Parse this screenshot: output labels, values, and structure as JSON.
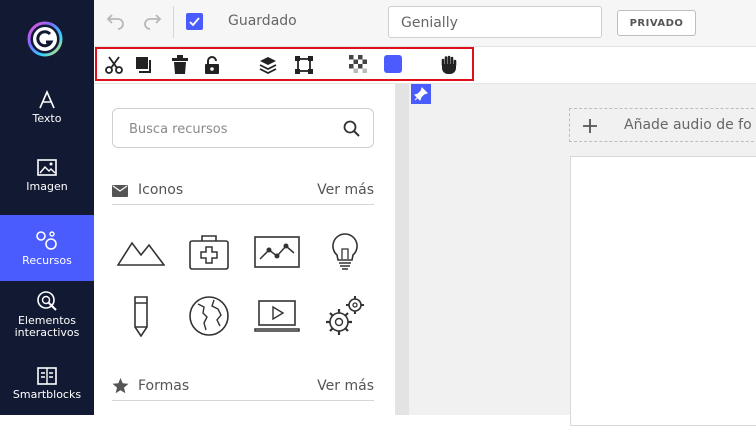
{
  "nav": {
    "items": [
      {
        "label": "Texto"
      },
      {
        "label": "Imagen"
      },
      {
        "label": "Recursos"
      },
      {
        "label": "Elementos interactivos"
      },
      {
        "label": "Smartblocks"
      }
    ]
  },
  "topbar": {
    "status": "Guardado",
    "title_value": "Genially",
    "privacy_label": "PRIVADO"
  },
  "toolbar": {
    "tools": [
      "scissors-icon",
      "duplicate-icon",
      "trash-icon",
      "lock-icon",
      "layers-icon",
      "transform-icon",
      "transparency-icon",
      "color-swatch-icon",
      "hand-icon"
    ],
    "swatch_color": "#4b5cff",
    "highlight_color": "#e0101b"
  },
  "panel": {
    "search_placeholder": "Busca recursos",
    "sections": [
      {
        "label": "Iconos",
        "more": "Ver más"
      },
      {
        "label": "Formas",
        "more": "Ver más"
      }
    ],
    "icons": [
      "mountains-icon",
      "first-aid-kit-icon",
      "line-chart-icon",
      "lightbulb-icon",
      "pencil-icon",
      "globe-icon",
      "laptop-video-icon",
      "gears-icon"
    ]
  },
  "canvas": {
    "audio_label": "Añade audio de fo"
  },
  "colors": {
    "rail": "#121a33",
    "accent": "#4b5cff"
  }
}
